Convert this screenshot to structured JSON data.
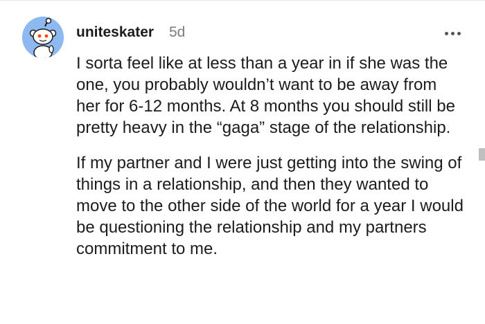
{
  "comment": {
    "username": "uniteskater",
    "timestamp": "5d",
    "paragraphs": [
      "I sorta feel like at less than a year in if she was the one, you probably wouldn’t want to be away from her for 6-12 months. At 8 months you should still be pretty heavy in the “gaga” stage of the relationship.",
      "If my partner and I were just getting into the swing of things in a relationship, and then they wanted to move to the other side of the world for a year I would be questioning the relationship and my partners commitment to me."
    ]
  },
  "icons": {
    "avatar": "snoo-avatar-icon",
    "more": "more-options-icon"
  },
  "colors": {
    "avatar_bg": "#8eb8f0",
    "timestamp": "#7c7c7c",
    "text": "#1c1c1c"
  }
}
